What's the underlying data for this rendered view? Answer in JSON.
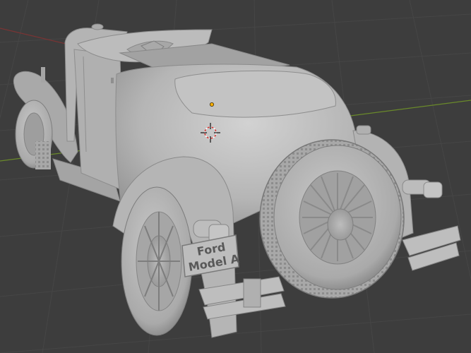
{
  "viewport": {
    "background": "#3d3d3d",
    "grid_color": "#474747",
    "x_axis_color": "#8a3a3a",
    "y_axis_color": "#6f8a2a"
  },
  "model": {
    "base_color": "#b9b9b9",
    "shadow_color": "#8f8f8f",
    "highlight_color": "#d9d9d9"
  },
  "license_plate": {
    "line1": "Ford",
    "line2": "Model A"
  },
  "gizmo": {
    "icon": "3d-cursor-icon",
    "origin_icon": "object-origin-icon",
    "origin_color": "#ffb000"
  }
}
